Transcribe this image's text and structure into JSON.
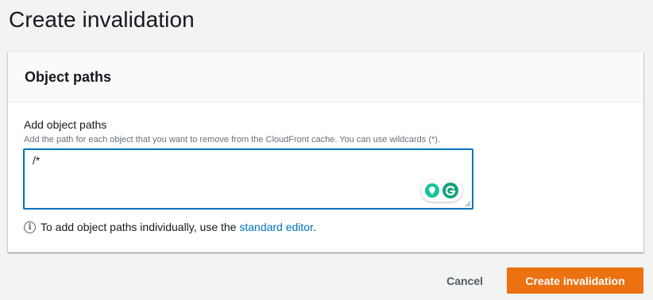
{
  "page": {
    "title": "Create invalidation"
  },
  "object_paths": {
    "heading": "Object paths",
    "field_label": "Add object paths",
    "field_description": "Add the path for each object that you want to remove from the CloudFront cache. You can use wildcards (*).",
    "field_value": "/*",
    "info_text": "To add object paths individually, use the",
    "info_link": "standard editor",
    "info_suffix": "."
  },
  "actions": {
    "cancel_label": "Cancel",
    "submit_label": "Create invalidation"
  },
  "icons": {
    "info": "info-circle-icon",
    "grammarly_bulb": "lightbulb-icon",
    "grammarly_logo": "grammarly-logo-icon"
  },
  "colors": {
    "primary_button": "#ec7211",
    "link": "#0073bb",
    "focus_border": "#0073bb",
    "background": "#f2f3f3"
  }
}
